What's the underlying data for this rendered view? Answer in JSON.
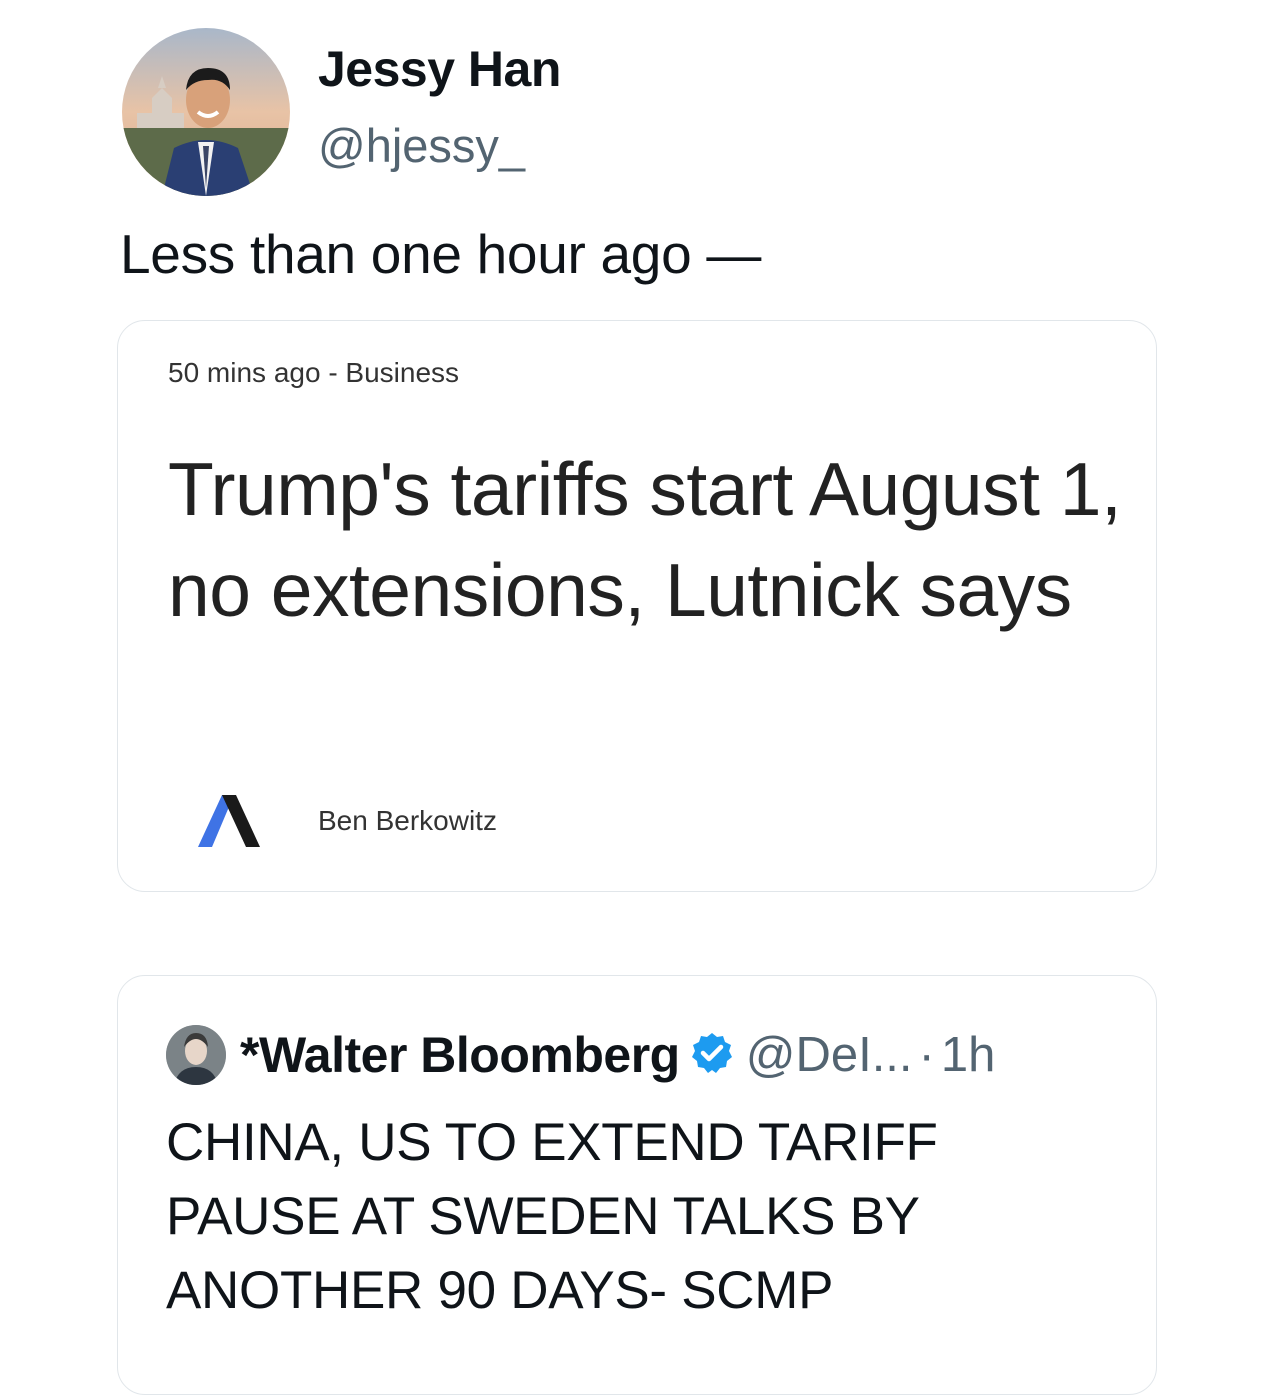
{
  "author": {
    "name": "Jessy Han",
    "handle": "@hjessy_"
  },
  "tweet": {
    "text": "Less than one hour ago —"
  },
  "article_card": {
    "meta": "50 mins ago - Business",
    "headline": "Trump's tariffs start August 1, no extensions, Lutnick says",
    "author": "Ben Berkowitz",
    "logo_icon": "axios-logo-icon"
  },
  "quoted_tweet": {
    "name": "*Walter Bloomberg",
    "verified_icon": "verified-badge-icon",
    "handle": "@DeI...",
    "separator": "·",
    "time": "1h",
    "text": "CHINA, US TO EXTEND TARIFF PAUSE AT SWEDEN TALKS BY ANOTHER 90 DAYS- SCMP"
  },
  "colors": {
    "verified_blue": "#1d9bf0",
    "secondary_text": "#536471",
    "card_border": "#e1e6ea"
  }
}
